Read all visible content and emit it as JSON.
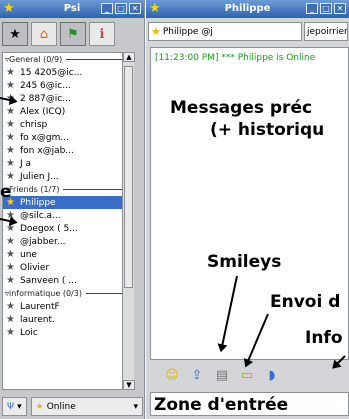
{
  "left_window": {
    "title": "Psi",
    "toolbar_icons": [
      "star-icon",
      "home-icon",
      "contacts-icon",
      "info-icon"
    ],
    "groups": [
      {
        "label": "General (0/9)",
        "contacts": [
          "15        4205@ic...",
          "245         6@ic...",
          "2         887@ic...",
          "Alex          (ICQ)",
          "chrisp               ",
          "fo          x@gm...",
          "fon          x@jab...",
          "J           a",
          "Julien            J..."
        ]
      },
      {
        "label": "Friends (1/7)",
        "contacts": [
          "Philippe",
          "         @silc.a...",
          "Doegox (        5...",
          "          @jabber...",
          "           une",
          "Olivier",
          "Sanveen (          ..."
        ]
      },
      {
        "label": "informatique (0/3)",
        "contacts": [
          "LaurentF           ",
          "laurent.          ",
          "Loic              "
        ]
      }
    ],
    "selected_contact": "Philippe",
    "status_combo": "Online"
  },
  "right_window": {
    "title": "Philippe",
    "dest_name": "Philippe               @j",
    "dest_jid": "jepoirrier",
    "log_message": "[11:23:00 PM] *** Philippe           is Online",
    "toolbar_icons": [
      "smiley-icon",
      "send-file-icon",
      "print-icon",
      "info-icon",
      "shield-icon"
    ]
  },
  "annotations": {
    "messages": "Messages préc",
    "historique": "(+ historiqu",
    "smileys": "Smileys",
    "envoi": "Envoi d",
    "info": "Info",
    "zone": "Zone d'entrée",
    "left_e": "e"
  }
}
